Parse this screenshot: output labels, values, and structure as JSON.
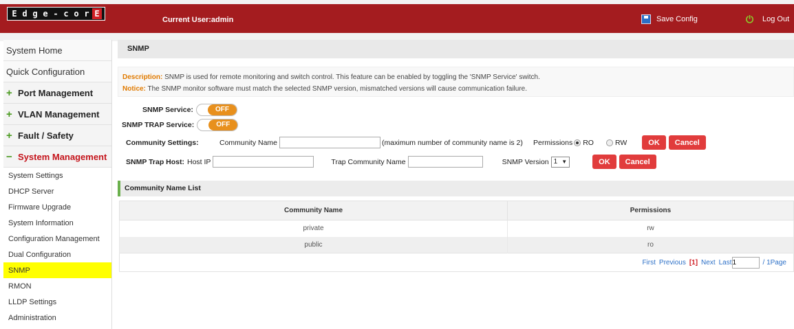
{
  "header": {
    "logo_letters": [
      "E",
      "d",
      "g",
      "e",
      "-",
      "c",
      "o",
      "r",
      "E"
    ],
    "current_user": "Current User:admin",
    "save_config": "Save Config",
    "log_out": "Log Out"
  },
  "sidebar": {
    "top_items": [
      "System Home",
      "Quick Configuration"
    ],
    "sections": [
      "Port Management",
      "VLAN Management",
      "Fault / Safety"
    ],
    "active_section": "System Management",
    "sub_items": [
      "System Settings",
      "DHCP Server",
      "Firmware Upgrade",
      "System Information",
      "Configuration Management",
      "Dual Configuration",
      "SNMP",
      "RMON",
      "LLDP Settings",
      "Administration"
    ],
    "selected": "SNMP"
  },
  "page": {
    "title": "SNMP",
    "description_key": "Description:",
    "description_text": " SNMP is used for remote monitoring and switch control. This feature can be enabled by toggling the 'SNMP Service' switch.",
    "notice_key": "Notice:",
    "notice_text": " The SNMP monitor software must match the selected SNMP version, mismatched versions will cause communication failure."
  },
  "snmp_service": {
    "label": "SNMP Service:",
    "state": "OFF"
  },
  "snmp_trap_service": {
    "label": "SNMP TRAP Service:",
    "state": "OFF"
  },
  "community": {
    "label": "Community Settings:",
    "name_label": "Community Name",
    "name_value": "",
    "hint": "(maximum number of community name is 2)",
    "permissions_label": "Permissions",
    "ro": "RO",
    "rw": "RW",
    "selected_permission": "RO",
    "ok": "OK",
    "cancel": "Cancel"
  },
  "trap_host": {
    "label": "SNMP Trap Host:",
    "host_ip_label": "Host IP",
    "host_ip_value": "",
    "trap_community_label": "Trap Community Name",
    "trap_community_value": "",
    "version_label": "SNMP Version",
    "version_value": "1",
    "version_arrow": "▼",
    "ok": "OK",
    "cancel": "Cancel"
  },
  "list": {
    "title": "Community Name List",
    "columns": [
      "Community Name",
      "Permissions"
    ],
    "rows": [
      {
        "name": "private",
        "perm": "rw"
      },
      {
        "name": "public",
        "perm": "ro"
      }
    ]
  },
  "pager": {
    "first": "First",
    "previous": "Previous",
    "current": "[1]",
    "next": "Next",
    "last": "Last",
    "page_input": "1",
    "total": "/ 1Page"
  }
}
